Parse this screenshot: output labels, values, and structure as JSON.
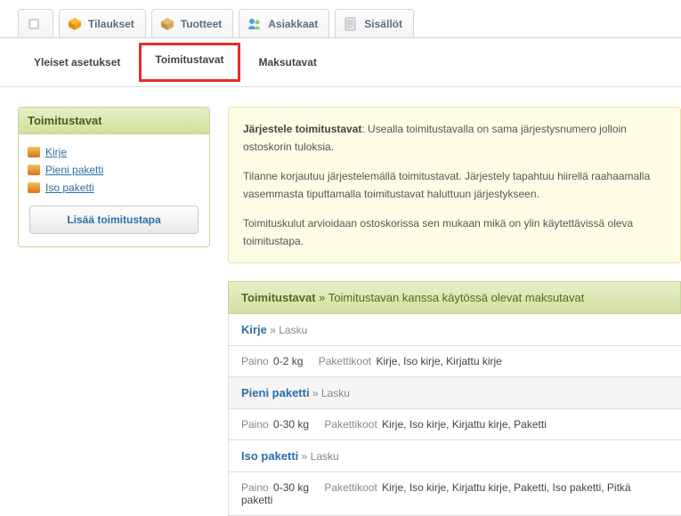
{
  "topTabs": [
    {
      "label": "",
      "iconColor": "#b9c4cc"
    },
    {
      "label": "Tilaukset",
      "iconColor": "#f4a11a"
    },
    {
      "label": "Tuotteet",
      "iconColor": "#d98a2a"
    },
    {
      "label": "Asiakkaat",
      "iconColor": "#3a8fd6"
    },
    {
      "label": "Sisällöt",
      "iconColor": "#b9c4cc"
    }
  ],
  "subTabs": [
    {
      "label": "Yleiset asetukset",
      "active": false
    },
    {
      "label": "Toimitustavat",
      "active": true
    },
    {
      "label": "Maksutavat",
      "active": false
    }
  ],
  "sidebar": {
    "title": "Toimitustavat",
    "items": [
      {
        "label": "Kirje"
      },
      {
        "label": "Pieni paketti"
      },
      {
        "label": "Iso paketti"
      }
    ],
    "addLabel": "Lisää toimitustapa"
  },
  "info": {
    "p1_strong": "Järjestele toimitustavat",
    "p1_rest": ": Usealla toimitustavalla on sama järjestysnumero jolloin ostoskorin tuloksia.",
    "p2": "Tilanne korjautuu järjestelemällä toimitustavat. Järjestely tapahtuu hiirellä raahaamalla vasemmasta tiputtamalla toimitustavat haluttuun järjestykseen.",
    "p3": "Toimituskulut arvioidaan ostoskorissa sen mukaan mikä on ylin käytettävissä oleva toimitustapa."
  },
  "table": {
    "heading_main": "Toimitustavat",
    "heading_sep": " » ",
    "heading_sub": "Toimitustavan kanssa käytössä olevat maksutavat",
    "weightLabel": "Paino",
    "sizesLabel": "Pakettikoot",
    "subPrefix": " » ",
    "rows": [
      {
        "name": "Kirje",
        "sub": "Lasku",
        "weight": "0-2 kg",
        "sizes": "Kirje, Iso kirje, Kirjattu kirje",
        "alt": false
      },
      {
        "name": "Pieni paketti",
        "sub": "Lasku",
        "weight": "0-30 kg",
        "sizes": "Kirje, Iso kirje, Kirjattu kirje, Paketti",
        "alt": true
      },
      {
        "name": "Iso paketti",
        "sub": "Lasku",
        "weight": "0-30 kg",
        "sizes": "Kirje, Iso kirje, Kirjattu kirje, Paketti, Iso paketti, Pitkä paketti",
        "alt": false
      }
    ]
  }
}
